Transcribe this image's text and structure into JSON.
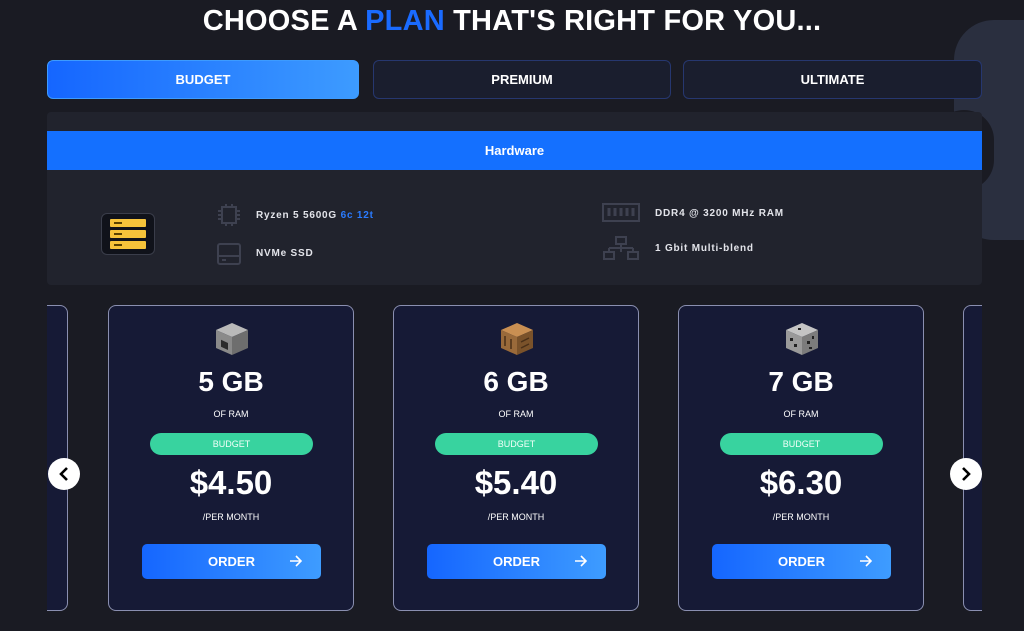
{
  "headline": {
    "part1": "CHOOSE A ",
    "accent": "PLAN",
    "part2": " THAT'S RIGHT FOR YOU..."
  },
  "tabs": [
    {
      "label": "BUDGET",
      "active": true
    },
    {
      "label": "PREMIUM",
      "active": false
    },
    {
      "label": "ULTIMATE",
      "active": false
    }
  ],
  "hardware": {
    "title": "Hardware",
    "cpu": {
      "model": "Ryzen 5 5600G",
      "cores": "6c",
      "threads": "12t"
    },
    "storage": "NVMe SSD",
    "ram": "DDR4 @ 3200 MHz RAM",
    "network": "1 Gbit Multi-blend"
  },
  "plans": [
    {
      "ram": "5 GB",
      "ram_label": "OF RAM",
      "tier": "BUDGET",
      "price": "$4.50",
      "period": "/PER MONTH",
      "order_label": "ORDER",
      "icon": "furnace-block-icon"
    },
    {
      "ram": "6 GB",
      "ram_label": "OF RAM",
      "tier": "BUDGET",
      "price": "$5.40",
      "period": "/PER MONTH",
      "order_label": "ORDER",
      "icon": "crafting-table-block-icon"
    },
    {
      "ram": "7 GB",
      "ram_label": "OF RAM",
      "tier": "BUDGET",
      "price": "$6.30",
      "period": "/PER MONTH",
      "order_label": "ORDER",
      "icon": "coal-ore-block-icon"
    }
  ],
  "colors": {
    "accent": "#1470ff",
    "badge": "#38d39f",
    "background": "#1a1b23",
    "card": "#161a36"
  }
}
